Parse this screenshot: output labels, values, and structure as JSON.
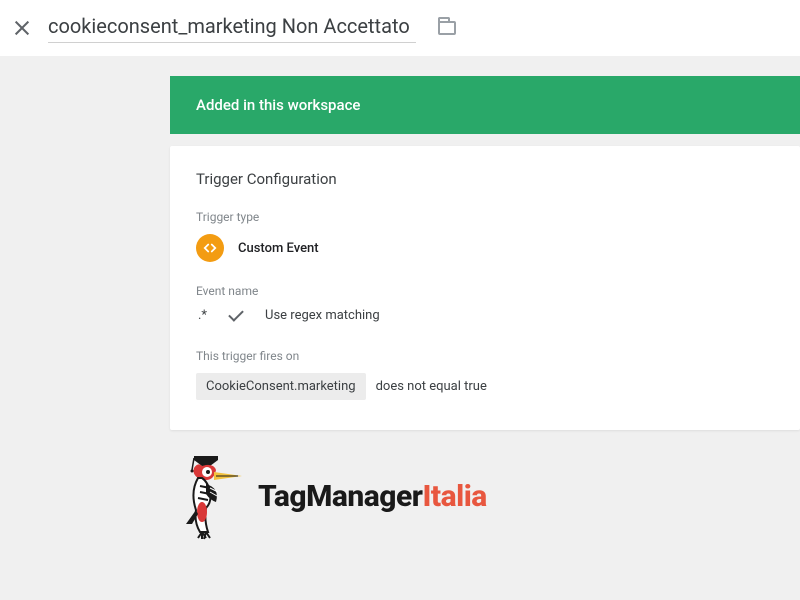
{
  "header": {
    "title": "cookieconsent_marketing Non Accettato"
  },
  "banner": {
    "text": "Added in this workspace"
  },
  "config": {
    "card_title": "Trigger Configuration",
    "type_label": "Trigger type",
    "type_value": "Custom Event",
    "event_name_label": "Event name",
    "event_name_value": ".*",
    "regex_label": "Use regex matching",
    "fires_label": "This trigger fires on",
    "fires_variable": "CookieConsent.marketing",
    "fires_condition": "does not equal true"
  },
  "logo": {
    "part1": "TagManager",
    "part2": "Italia"
  }
}
